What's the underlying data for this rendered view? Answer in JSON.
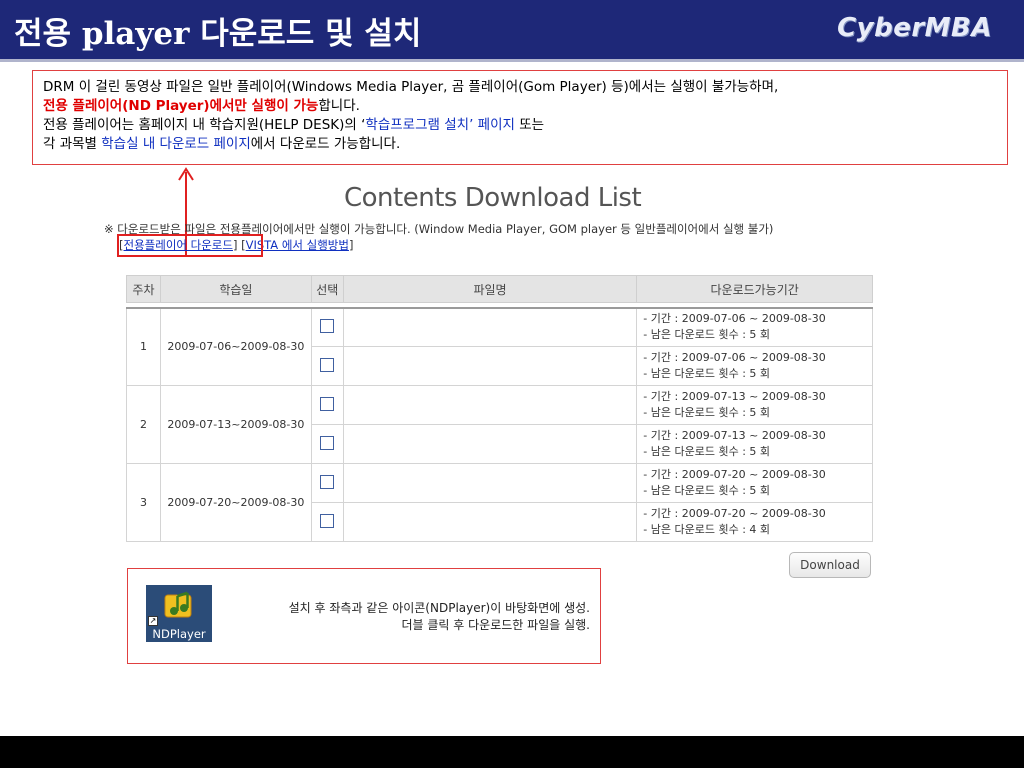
{
  "header": {
    "title": "전용 player 다운로드 및 설치",
    "brand": "CyberMBA"
  },
  "notice": {
    "line1": "DRM 이 걸린 동영상 파일은 일반 플레이어(Windows Media Player, 곰 플레이어(Gom Player) 등)에서는 실행이 불가능하며,",
    "line2_red": "전용 플레이어(ND Player)에서만 실행이 가능",
    "line2_rest": "합니다.",
    "line3_pre": "전용 플레이어는 홈페이지 내 학습지원(HELP DESK)의 ‘",
    "line3_blue1": "학습프로그램 설치",
    "line3_mid": "’ ",
    "line3_blue2": "페이지",
    "line3_post": " 또는",
    "line4_pre": "각 과목별 ",
    "line4_blue": "학습실 내 다운로드 페이지",
    "line4_post": "에서 다운로드 가능합니다."
  },
  "download_page": {
    "title": "Contents Download List",
    "note": "※ 다운로드받은 파일은 전용플레이어에서만 실행이 가능합니다. (Window Media Player, GOM player 등 일반플레이어에서 실행 불가)",
    "link_player": "전용플레이어 다운로드",
    "link_vista": "VISTA 에서 실행방법",
    "columns": [
      "주차",
      "학습일",
      "선택",
      "파일명",
      "다운로드가능기간"
    ],
    "weeks": [
      {
        "week": "1",
        "date": "2009-07-06~2009-08-30",
        "files": [
          {
            "filename": "",
            "period": "- 기간 : 2009-07-06 ~ 2009-08-30",
            "remaining": "- 남은 다운로드 횟수 : 5 회"
          },
          {
            "filename": "",
            "period": "- 기간 : 2009-07-06 ~ 2009-08-30",
            "remaining": "- 남은 다운로드 횟수 : 5 회"
          }
        ]
      },
      {
        "week": "2",
        "date": "2009-07-13~2009-08-30",
        "files": [
          {
            "filename": "",
            "period": "- 기간 : 2009-07-13 ~ 2009-08-30",
            "remaining": "- 남은 다운로드 횟수 : 5 회"
          },
          {
            "filename": "",
            "period": "- 기간 : 2009-07-13 ~ 2009-08-30",
            "remaining": "- 남은 다운로드 횟수 : 5 회"
          }
        ]
      },
      {
        "week": "3",
        "date": "2009-07-20~2009-08-30",
        "files": [
          {
            "filename": "",
            "period": "- 기간 : 2009-07-20 ~ 2009-08-30",
            "remaining": "- 남은 다운로드 횟수 : 5 회"
          },
          {
            "filename": "",
            "period": "- 기간 : 2009-07-20 ~ 2009-08-30",
            "remaining": "- 남은 다운로드 횟수 : 4 회"
          }
        ]
      }
    ],
    "download_button": "Download"
  },
  "install": {
    "icon_label": "NDPlayer",
    "line1": "설치 후 좌측과 같은 아이콘(NDPlayer)이 바탕화면에 생성.",
    "line2": "더블 클릭 후 다운로드한 파일을 실행."
  },
  "colors": {
    "header_bg": "#1e2878",
    "emphasis_red": "#e00000",
    "link_blue": "#1030c0"
  }
}
